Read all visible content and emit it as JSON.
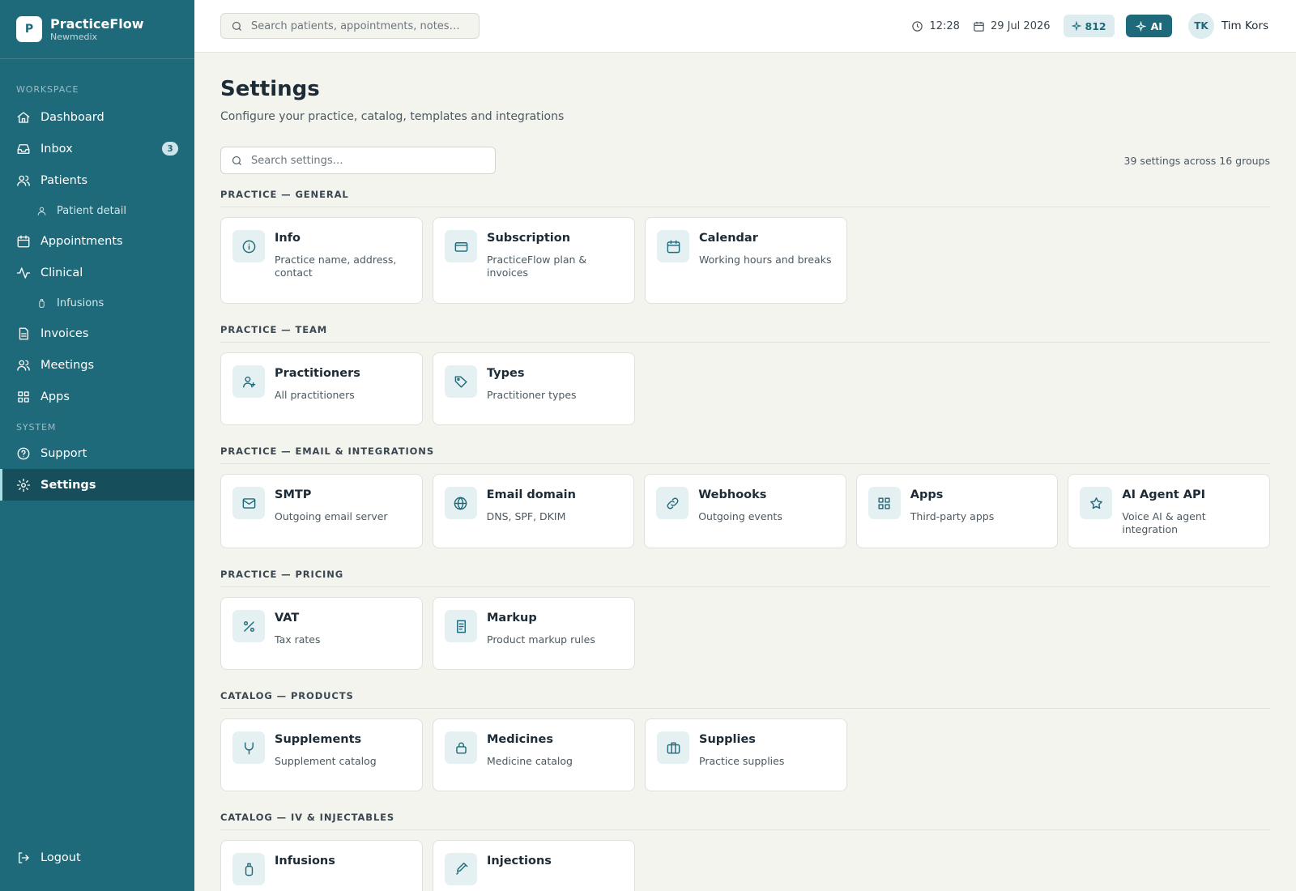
{
  "brand": {
    "logo_letter": "P",
    "name": "PracticeFlow",
    "subtitle": "Newmedix"
  },
  "sidebar": {
    "section_workspace": "WORKSPACE",
    "section_system": "SYSTEM",
    "items": [
      {
        "label": "Dashboard",
        "icon": "home-icon"
      },
      {
        "label": "Inbox",
        "icon": "inbox-icon",
        "badge": "3"
      },
      {
        "label": "Patients",
        "icon": "users-icon"
      },
      {
        "label": "Patient detail",
        "icon": "user-icon",
        "sub": true
      },
      {
        "label": "Appointments",
        "icon": "calendar-icon"
      },
      {
        "label": "Clinical",
        "icon": "activity-icon"
      },
      {
        "label": "Infusions",
        "icon": "drip-icon",
        "sub": true
      },
      {
        "label": "Invoices",
        "icon": "file-icon"
      },
      {
        "label": "Meetings",
        "icon": "users-icon"
      },
      {
        "label": "Apps",
        "icon": "grid-icon"
      }
    ],
    "system_items": [
      {
        "label": "Support",
        "icon": "help-circle-icon"
      },
      {
        "label": "Settings",
        "icon": "gear-icon",
        "active": true
      }
    ],
    "logout": "Logout"
  },
  "topbar": {
    "search_placeholder": "Search patients, appointments, notes…",
    "time": "12:28",
    "date": "29 Jul 2026",
    "credits": "812",
    "ai_label": "AI",
    "user_initials": "TK",
    "user_name": "Tim Kors"
  },
  "page": {
    "title": "Settings",
    "subtitle": "Configure your practice, catalog, templates and integrations",
    "search_placeholder": "Search settings…",
    "count": "39 settings across 16 groups"
  },
  "groups": [
    {
      "title": "PRACTICE — GENERAL",
      "cards": [
        {
          "title": "Info",
          "desc": "Practice name, address, contact",
          "icon": "info-icon"
        },
        {
          "title": "Subscription",
          "desc": "PracticeFlow plan & invoices",
          "icon": "credit-card-icon"
        },
        {
          "title": "Calendar",
          "desc": "Working hours and breaks",
          "icon": "calendar-icon"
        }
      ]
    },
    {
      "title": "PRACTICE — TEAM",
      "cards": [
        {
          "title": "Practitioners",
          "desc": "All practitioners",
          "icon": "practitioner-icon"
        },
        {
          "title": "Types",
          "desc": "Practitioner types",
          "icon": "tag-icon"
        }
      ]
    },
    {
      "title": "PRACTICE — EMAIL & INTEGRATIONS",
      "cards": [
        {
          "title": "SMTP",
          "desc": "Outgoing email server",
          "icon": "mail-icon"
        },
        {
          "title": "Email domain",
          "desc": "DNS, SPF, DKIM",
          "icon": "globe-icon"
        },
        {
          "title": "Webhooks",
          "desc": "Outgoing events",
          "icon": "link-icon"
        },
        {
          "title": "Apps",
          "desc": "Third-party apps",
          "icon": "grid-icon"
        },
        {
          "title": "AI Agent API",
          "desc": "Voice AI & agent integration",
          "icon": "star-icon"
        }
      ]
    },
    {
      "title": "PRACTICE — PRICING",
      "cards": [
        {
          "title": "VAT",
          "desc": "Tax rates",
          "icon": "percent-icon"
        },
        {
          "title": "Markup",
          "desc": "Product markup rules",
          "icon": "receipt-icon"
        }
      ]
    },
    {
      "title": "CATALOG — PRODUCTS",
      "cards": [
        {
          "title": "Supplements",
          "desc": "Supplement catalog",
          "icon": "stethoscope-icon"
        },
        {
          "title": "Medicines",
          "desc": "Medicine catalog",
          "icon": "lock-bag-icon"
        },
        {
          "title": "Supplies",
          "desc": "Practice supplies",
          "icon": "briefcase-icon"
        }
      ]
    },
    {
      "title": "CATALOG — IV & INJECTABLES",
      "cards": [
        {
          "title": "Infusions",
          "desc": "",
          "icon": "drip-icon"
        },
        {
          "title": "Injections",
          "desc": "",
          "icon": "syringe-icon"
        }
      ]
    }
  ],
  "colors": {
    "sidebar": "#1e6a7a",
    "sidebar_active": "#174e5c",
    "accent": "#1e6a7a",
    "background": "#f4f4ef"
  }
}
